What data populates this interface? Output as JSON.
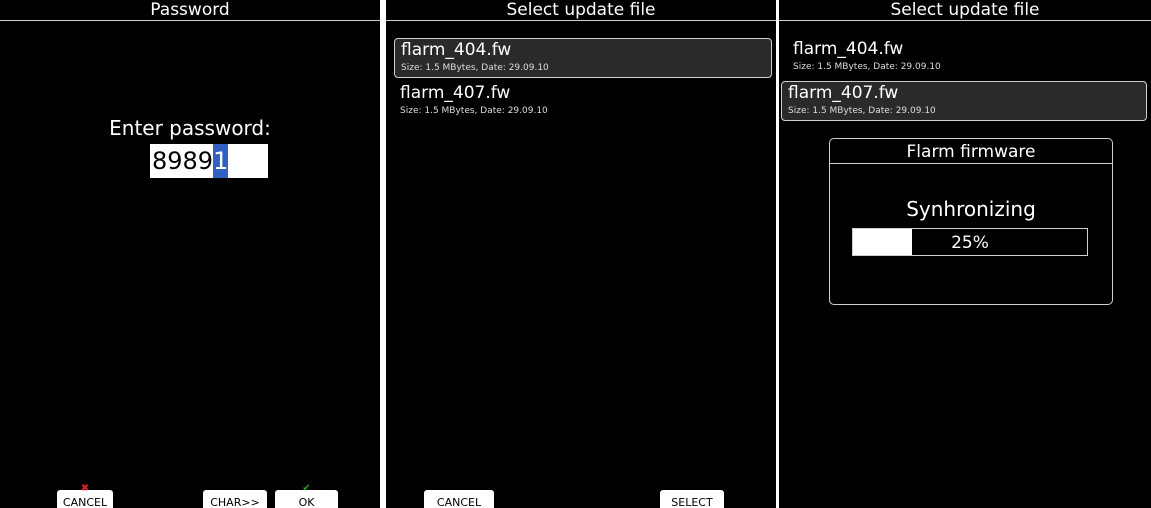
{
  "password_screen": {
    "title": "Password",
    "prompt": "Enter password:",
    "entered": "8989",
    "cursor_char": "1",
    "buttons": {
      "cancel": "CANCEL",
      "char": "CHAR>>",
      "ok": "OK"
    },
    "icons": {
      "cancel": "red-x-icon",
      "ok": "green-check-icon"
    }
  },
  "file_select_screen": {
    "title": "Select update file",
    "files": [
      {
        "name": "flarm_404.fw",
        "meta": "Size: 1.5 MBytes, Date: 29.09.10"
      },
      {
        "name": "flarm_407.fw",
        "meta": "Size: 1.5 MBytes, Date: 29.09.10"
      }
    ],
    "selected_index": 0,
    "buttons": {
      "cancel": "CANCEL",
      "select": "SELECT"
    }
  },
  "sync_screen": {
    "title": "Select update file",
    "files": [
      {
        "name": "flarm_404.fw",
        "meta": "Size: 1.5 MBytes, Date: 29.09.10"
      },
      {
        "name": "flarm_407.fw",
        "meta": "Size: 1.5 MBytes, Date: 29.09.10"
      }
    ],
    "selected_index": 1,
    "dialog": {
      "title": "Flarm firmware",
      "message": "Synhronizing",
      "progress_label": "25%",
      "progress": 0.25
    }
  },
  "colors": {
    "background": "#000000",
    "foreground": "#ffffff",
    "cursor": "#3060c0",
    "cancel_icon": "#e02020",
    "ok_icon": "#20a020"
  }
}
